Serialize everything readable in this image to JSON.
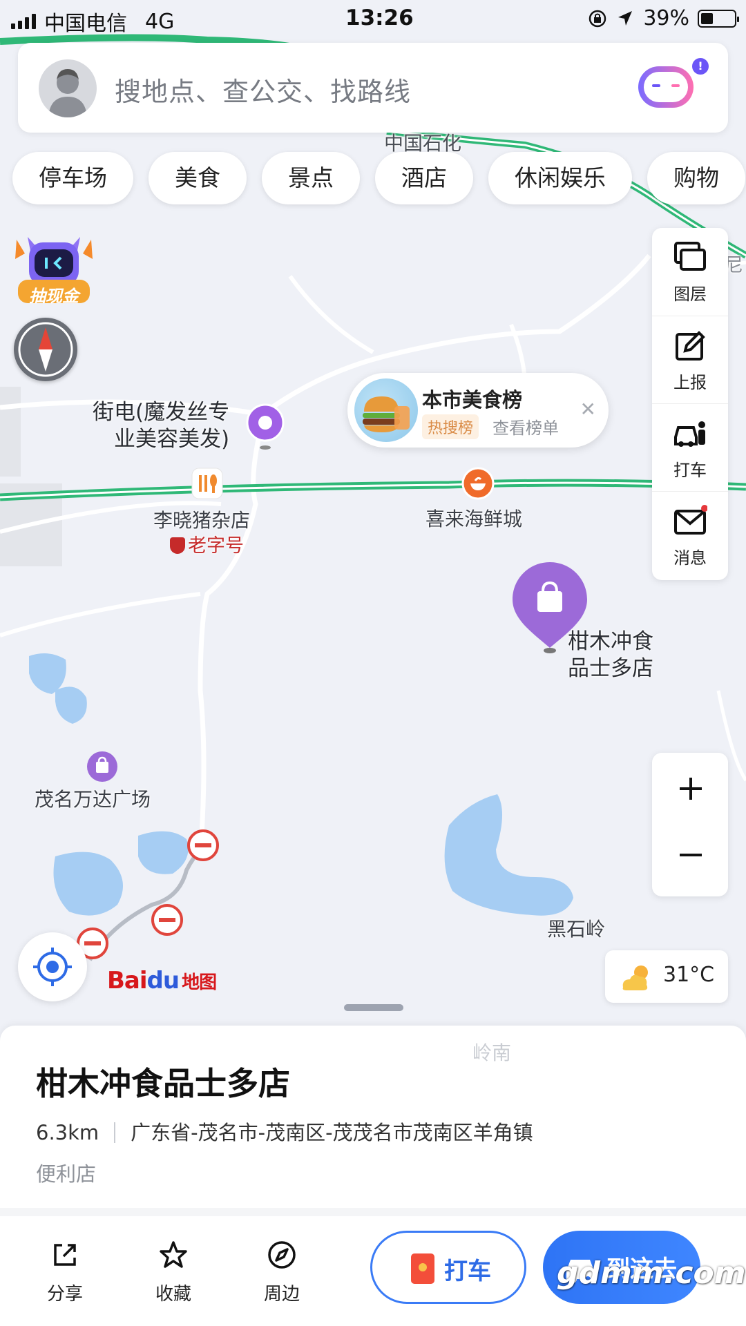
{
  "status_bar": {
    "carrier": "中国电信",
    "network": "4G",
    "time": "13:26",
    "battery": "39%"
  },
  "search": {
    "placeholder": "搜地点、查公交、找路线",
    "badge": "!"
  },
  "categories": [
    "停车场",
    "美食",
    "景点",
    "酒店",
    "休闲娱乐",
    "购物"
  ],
  "lottery_label": "抽现金",
  "tools": [
    {
      "label": "图层",
      "icon": "layers-icon"
    },
    {
      "label": "上报",
      "icon": "report-icon"
    },
    {
      "label": "打车",
      "icon": "taxi-icon"
    },
    {
      "label": "消息",
      "icon": "message-icon"
    }
  ],
  "zoom": {
    "in": "+",
    "out": "−"
  },
  "popup": {
    "title": "本市美食榜",
    "tag": "热搜榜",
    "link": "查看榜单",
    "close": "✕"
  },
  "map_labels": {
    "top_road": "中国石化",
    "salon": "街电(魔发丝专",
    "salon_line2": "业美容美发)",
    "restaurant1": "李晓猪杂店",
    "restaurant1_badge": "老字号",
    "restaurant2": "喜来海鲜城",
    "store": "柑木冲食",
    "store_line2": "品士多店",
    "mall": "茂名万达广场",
    "hill": "黑石岭",
    "area": "岭南",
    "edge": "尼"
  },
  "logo": {
    "bai": "Bai",
    "du": "du",
    "tu": "地图"
  },
  "weather": {
    "temp": "31°C",
    "icon": "partly-cloudy-icon"
  },
  "place": {
    "title": "柑木冲食品士多店",
    "distance": "6.3km",
    "address": "广东省-茂名市-茂南区-茂茂名市茂南区羊角镇",
    "category": "便利店"
  },
  "actions": [
    {
      "label": "分享",
      "icon": "share-icon"
    },
    {
      "label": "收藏",
      "icon": "star-icon"
    },
    {
      "label": "周边",
      "icon": "compass-icon"
    }
  ],
  "buttons": {
    "taxi": "打车",
    "go": "到这去"
  },
  "watermark": "gdmm.com",
  "colors": {
    "accent": "#3a7bf6",
    "road_green": "#4cc48a",
    "water": "#a6cdf3",
    "poi_purple": "#9c6ad8"
  }
}
